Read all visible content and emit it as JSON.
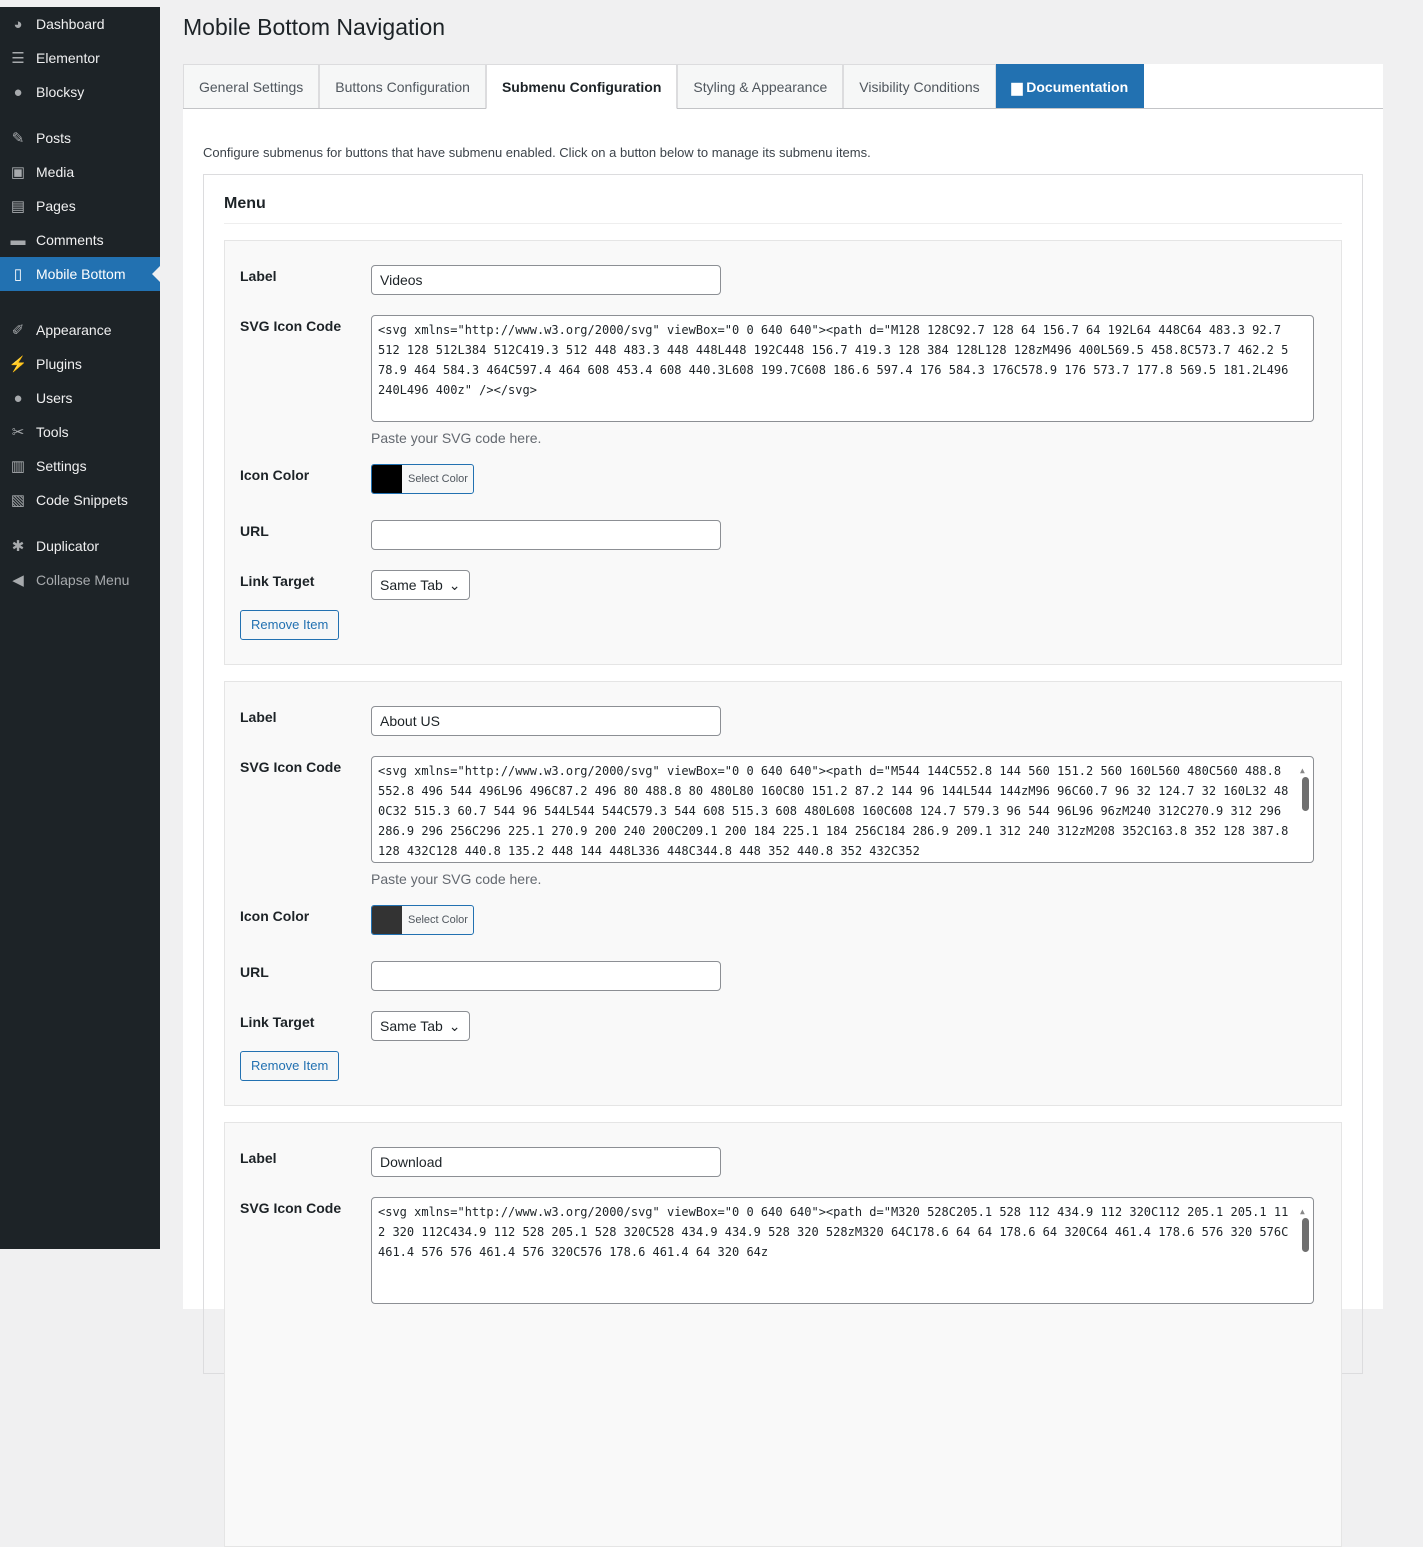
{
  "sidebar": {
    "items": [
      {
        "label": "Dashboard",
        "icon": "dashboard-icon"
      },
      {
        "label": "Elementor",
        "icon": "elementor-icon"
      },
      {
        "label": "Blocksy",
        "icon": "blocksy-icon"
      },
      {
        "label": "Posts",
        "icon": "pin-icon"
      },
      {
        "label": "Media",
        "icon": "media-icon"
      },
      {
        "label": "Pages",
        "icon": "pages-icon"
      },
      {
        "label": "Comments",
        "icon": "comment-icon"
      },
      {
        "label": "Mobile Bottom",
        "icon": "mobile-icon"
      },
      {
        "label": "Appearance",
        "icon": "brush-icon"
      },
      {
        "label": "Plugins",
        "icon": "plug-icon"
      },
      {
        "label": "Users",
        "icon": "user-icon"
      },
      {
        "label": "Tools",
        "icon": "wrench-icon"
      },
      {
        "label": "Settings",
        "icon": "sliders-icon"
      },
      {
        "label": "Code Snippets",
        "icon": "code-icon"
      },
      {
        "label": "Duplicator",
        "icon": "duplicator-icon"
      },
      {
        "label": "Collapse Menu",
        "icon": "collapse-icon"
      }
    ]
  },
  "page": {
    "title": "Mobile Bottom Navigation",
    "tabs": [
      "General Settings",
      "Buttons Configuration",
      "Submenu Configuration",
      "Styling & Appearance",
      "Visibility Conditions",
      "Documentation"
    ],
    "intro": "Configure submenus for buttons that have submenu enabled. Click on a button below to manage its submenu items.",
    "card_title": "Menu",
    "field_labels": {
      "label": "Label",
      "svg": "SVG Icon Code",
      "color": "Icon Color",
      "url": "URL",
      "target": "Link Target"
    },
    "svg_hint": "Paste your SVG code here.",
    "select_color": "Select Color",
    "remove": "Remove Item",
    "items": [
      {
        "label": "Videos",
        "color": "#000000",
        "url": "",
        "target": "Same Tab",
        "svg": "<svg xmlns=\"http://www.w3.org/2000/svg\" viewBox=\"0 0 640 640\"><path d=\"M128 128C92.7 128 64 156.7 64 192L64 448C64 483.3 92.7 512 128 512L384 512C419.3 512 448 483.3 448 448L448 192C448 156.7 419.3 128 384 128L128 128zM496 400L569.5 458.8C573.7 462.2 578.9 464 584.3 464C597.4 464 608 453.4 608 440.3L608 199.7C608 186.6 597.4 176 584.3 176C578.9 176 573.7 177.8 569.5 181.2L496 240L496 400z\" /></svg>"
      },
      {
        "label": "About US",
        "color": "#333333",
        "url": "",
        "target": "Same Tab",
        "svg": "<svg xmlns=\"http://www.w3.org/2000/svg\" viewBox=\"0 0 640 640\"><path d=\"M544 144C552.8 144 560 151.2 560 160L560 480C560 488.8 552.8 496 544 496L96 496C87.2 496 80 488.8 80 480L80 160C80 151.2 87.2 144 96 144L544 144zM96 96C60.7 96 32 124.7 32 160L32 480C32 515.3 60.7 544 96 544L544 544C579.3 544 608 515.3 608 480L608 160C608 124.7 579.3 96 544 96L96 96zM240 312C270.9 312 296 286.9 296 256C296 225.1 270.9 200 240 200C209.1 200 184 225.1 184 256C184 286.9 209.1 312 240 312zM208 352C163.8 352 128 387.8 128 432C128 440.8 135.2 448 144 448L336 448C344.8 448 352 440.8 352 432C352"
      },
      {
        "label": "Download",
        "svg": "<svg xmlns=\"http://www.w3.org/2000/svg\" viewBox=\"0 0 640 640\"><path d=\"M320 528C205.1 528 112 434.9 112 320C112 205.1 205.1 112 320 112C434.9 112 528 205.1 528 320C528 434.9 434.9 528 320 528zM320 64C178.6 64 64 178.6 64 320C64 461.4 178.6 576 320 576C461.4 576 576 461.4 576 320C576 178.6 461.4 64 320 64z"
      }
    ]
  }
}
